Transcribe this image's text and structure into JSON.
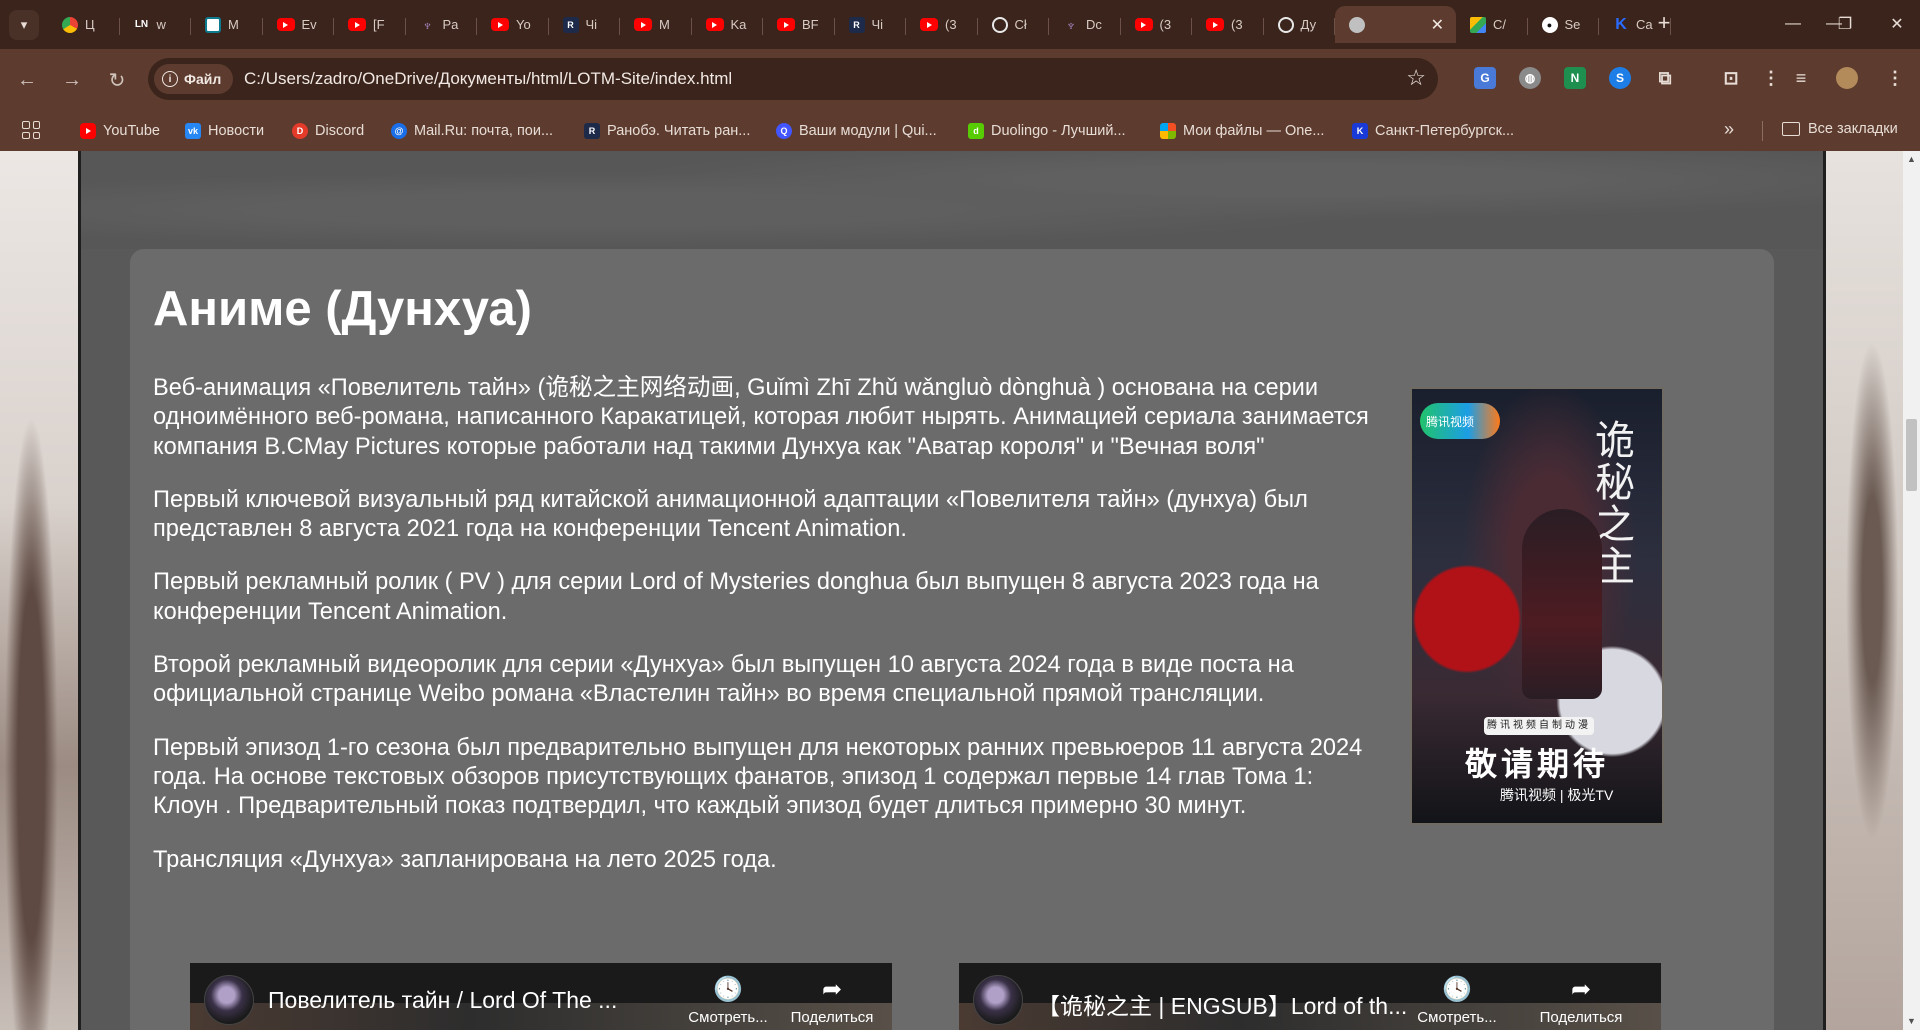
{
  "tabs": [
    {
      "title": "Ц",
      "icon": "chrome-icon"
    },
    {
      "title": "w",
      "icon": "lp-icon"
    },
    {
      "title": "M",
      "icon": "doc-icon"
    },
    {
      "title": "Ev",
      "icon": "youtube-icon"
    },
    {
      "title": "[F",
      "icon": "youtube-icon"
    },
    {
      "title": "Pa",
      "icon": "mask-icon"
    },
    {
      "title": "Yo",
      "icon": "youtube-icon"
    },
    {
      "title": "Чі",
      "icon": "ranobe-icon"
    },
    {
      "title": "M",
      "icon": "youtube-icon"
    },
    {
      "title": "Ka",
      "icon": "youtube-icon"
    },
    {
      "title": "BF",
      "icon": "youtube-icon"
    },
    {
      "title": "Чі",
      "icon": "ranobe-icon"
    },
    {
      "title": "(3",
      "icon": "youtube-icon"
    },
    {
      "title": "Cł",
      "icon": "chatgpt-icon"
    },
    {
      "title": "Dc",
      "icon": "mask-icon"
    },
    {
      "title": "(3",
      "icon": "youtube-icon"
    },
    {
      "title": "(3",
      "icon": "youtube-icon"
    },
    {
      "title": "Ду",
      "icon": "chatgpt-icon"
    },
    {
      "title": "",
      "icon": "globe-icon",
      "active": true
    },
    {
      "title": "С/",
      "icon": "drive-icon"
    },
    {
      "title": "Se",
      "icon": "github-icon"
    },
    {
      "title": "Ca",
      "icon": "k-icon"
    }
  ],
  "toolbar": {
    "site_label": "Файл",
    "url": "C:/Users/zadro/OneDrive/Документы/html/LOTM-Site/index.html"
  },
  "bookmarks": [
    {
      "label": "YouTube",
      "icon": "youtube-icon"
    },
    {
      "label": "Новости",
      "icon": "vk-icon"
    },
    {
      "label": "Discord",
      "icon": "discord-icon"
    },
    {
      "label": "Mail.Ru: почта, пои...",
      "icon": "mailru-icon"
    },
    {
      "label": "Ранобэ. Читать ран...",
      "icon": "ranobe-icon"
    },
    {
      "label": "Ваши модули | Qui...",
      "icon": "quizlet-icon"
    },
    {
      "label": "Duolingo - Лучший...",
      "icon": "duolingo-icon"
    },
    {
      "label": "Мои файлы — One...",
      "icon": "microsoft-icon"
    },
    {
      "label": "Санкт-Петербургск...",
      "icon": "spb-icon"
    }
  ],
  "bookmarks_all_label": "Все закладки",
  "section": {
    "title": "Аниме (Дунхуа)",
    "paragraphs": [
      "Веб-анимация «Повелитель тайн» (诡秘之主网络动画, Guǐmì Zhī Zhǔ wǎngluò dònghuà ) основана на серии одноимённого веб-романа, написанного Каракатицей, которая любит нырять. Анимацией сериала занимается компания B.CMay Pictures которые работали над такими Дунхуа как \"Аватар короля\" и \"Вечная воля\"",
      "Первый ключевой визуальный ряд китайской анимационной адаптации «Повелителя тайн» (дунхуа) был представлен 8 августа 2021 года на конференции Tencent Animation.",
      "Первый рекламный ролик ( PV ) для серии Lord of Mysteries donghua был выпущен 8 августа 2023 года на конференции Tencent Animation.",
      "Второй рекламный видеоролик для серии «Дунхуа» был выпущен 10 августа 2024 года в виде поста на официальной странице Weibo романа «Властелин тайн» во время специальной прямой трансляции.",
      "Первый эпизод 1-го сезона был предварительно выпущен для некоторых ранних превьюеров 11 августа 2024 года. На основе текстовых обзоров присутствующих фанатов, эпизод 1 содержал первые 14 глав Тома 1: Клоун . Предварительный показ подтвердил, что каждый эпизод будет длиться примерно 30 минут.",
      "Трансляция «Дунхуа» запланирована на лето 2025 года."
    ],
    "poster": {
      "logo_text": "腾讯视频",
      "title": "诡秘之主",
      "banner": "腾讯视频自制动漫",
      "cta": "敬请期待",
      "platform": "腾讯视频 | 极光TV"
    }
  },
  "videos": [
    {
      "title": "Повелитель тайн / Lord Of The ...",
      "watch_later": "Смотреть...",
      "share": "Поделиться"
    },
    {
      "title": "【诡秘之主 | ENGSUB】Lord of th...",
      "watch_later": "Смотреть...",
      "share": "Поделиться"
    }
  ]
}
